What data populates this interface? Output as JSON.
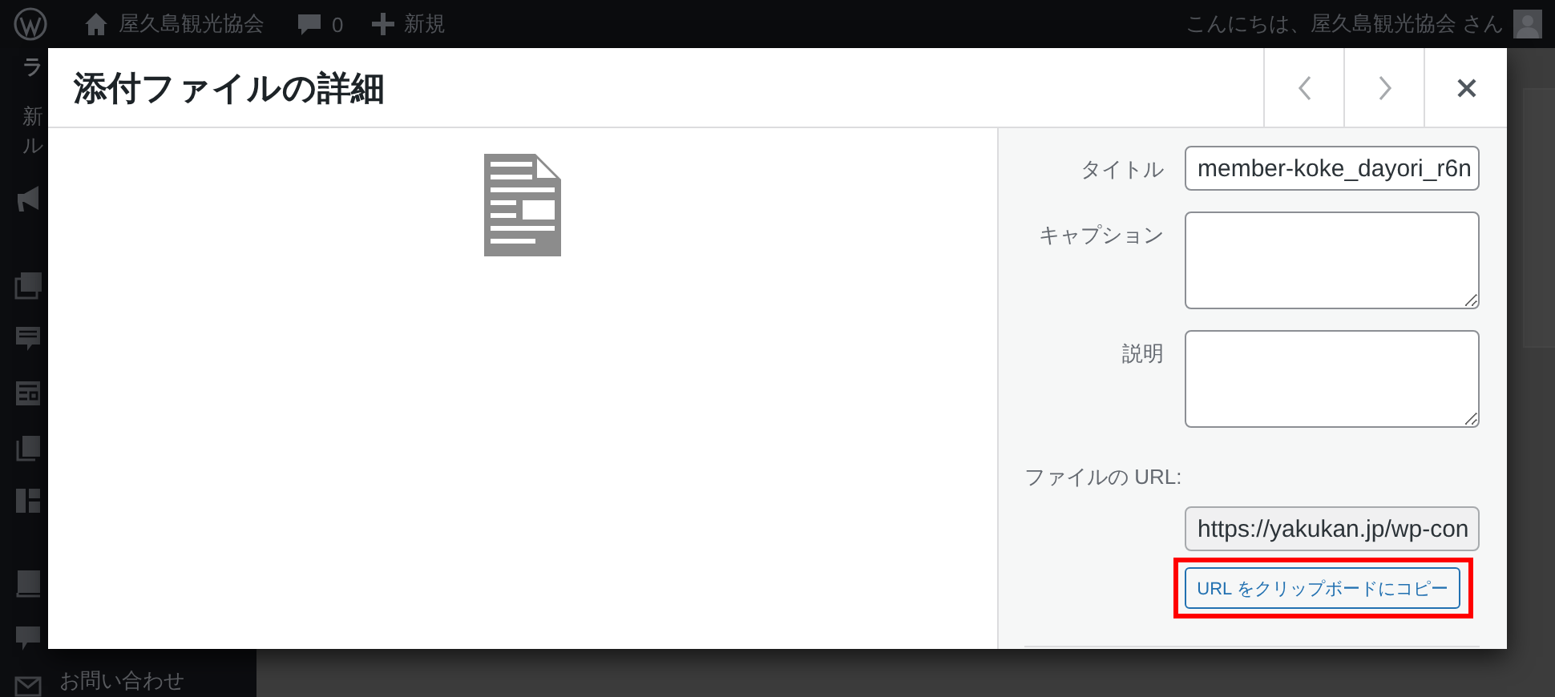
{
  "admin_bar": {
    "site_name": "屋久島観光協会",
    "comments_count": "0",
    "new_label": "新規",
    "greeting": "こんにちは、屋久島観光協会 さん"
  },
  "background_menu": [
    {
      "text": "ラ",
      "kind": "heading"
    },
    {
      "text": "新",
      "kind": "item"
    },
    {
      "text": "ル",
      "kind": "item"
    },
    {
      "text": "お問い合わせ",
      "kind": "item"
    }
  ],
  "modal": {
    "title": "添付ファイルの詳細",
    "fields": [
      {
        "label": "タイトル",
        "kind": "input",
        "value": "member-koke_dayori_r6n"
      },
      {
        "label": "キャプション",
        "kind": "textarea"
      },
      {
        "label": "説明",
        "kind": "textarea"
      }
    ],
    "file_url": {
      "label": "ファイルの URL:",
      "value": "https://yakukan.jp/wp-con",
      "copy_button": "URL をクリップボードにコピー",
      "highlighted": true
    }
  }
}
